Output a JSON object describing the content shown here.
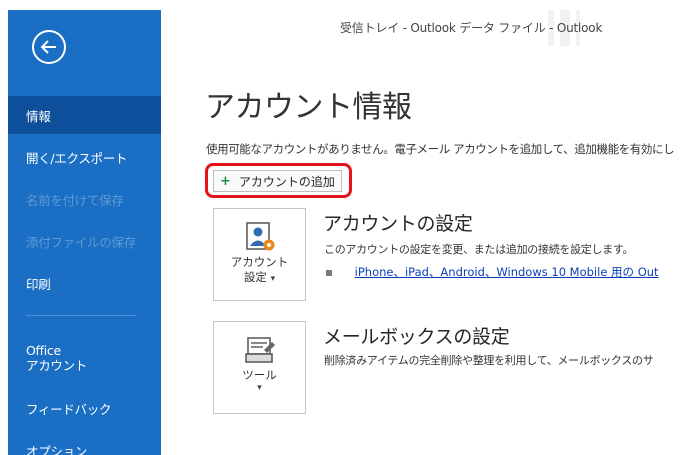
{
  "window": {
    "title": "受信トレイ - Outlook データ ファイル  -  Outlook"
  },
  "sidebar": {
    "items": [
      {
        "label": "情報",
        "state": "selected"
      },
      {
        "label": "開く/エクスポート",
        "state": "enabled"
      },
      {
        "label": "名前を付けて保存",
        "state": "disabled"
      },
      {
        "label": "添付ファイルの保存",
        "state": "disabled"
      },
      {
        "label": "印刷",
        "state": "enabled"
      },
      {
        "label_line1": "Office",
        "label_line2": "アカウント",
        "state": "enabled"
      },
      {
        "label": "フィードバック",
        "state": "enabled"
      },
      {
        "label": "オプション",
        "state": "enabled"
      }
    ]
  },
  "main": {
    "title": "アカウント情報",
    "info_text": "使用可能なアカウントがありません。電子メール アカウントを追加して、追加機能を有効にし",
    "add_account_label": "アカウントの追加",
    "account_settings": {
      "tile_line1": "アカウント",
      "tile_line2": "設定",
      "heading": "アカウントの設定",
      "description": "このアカウントの設定を変更、または追加の接続を設定します。",
      "link": "iPhone、iPad、Android、Windows 10 Mobile 用の Out"
    },
    "mailbox_settings": {
      "tile_label": "ツール",
      "heading": "メールボックスの設定",
      "description": "削除済みアイテムの完全削除や整理を利用して、メールボックスのサ"
    }
  },
  "colors": {
    "sidebar_bg": "#1a6fc4",
    "sidebar_selected": "#0d4f9a",
    "highlight_border": "#e3141b",
    "link": "#0b3fb8"
  },
  "icons": [
    "back-arrow-icon",
    "plus-icon",
    "account-settings-icon",
    "tools-icon",
    "bullet-icon",
    "caret-down-icon"
  ]
}
